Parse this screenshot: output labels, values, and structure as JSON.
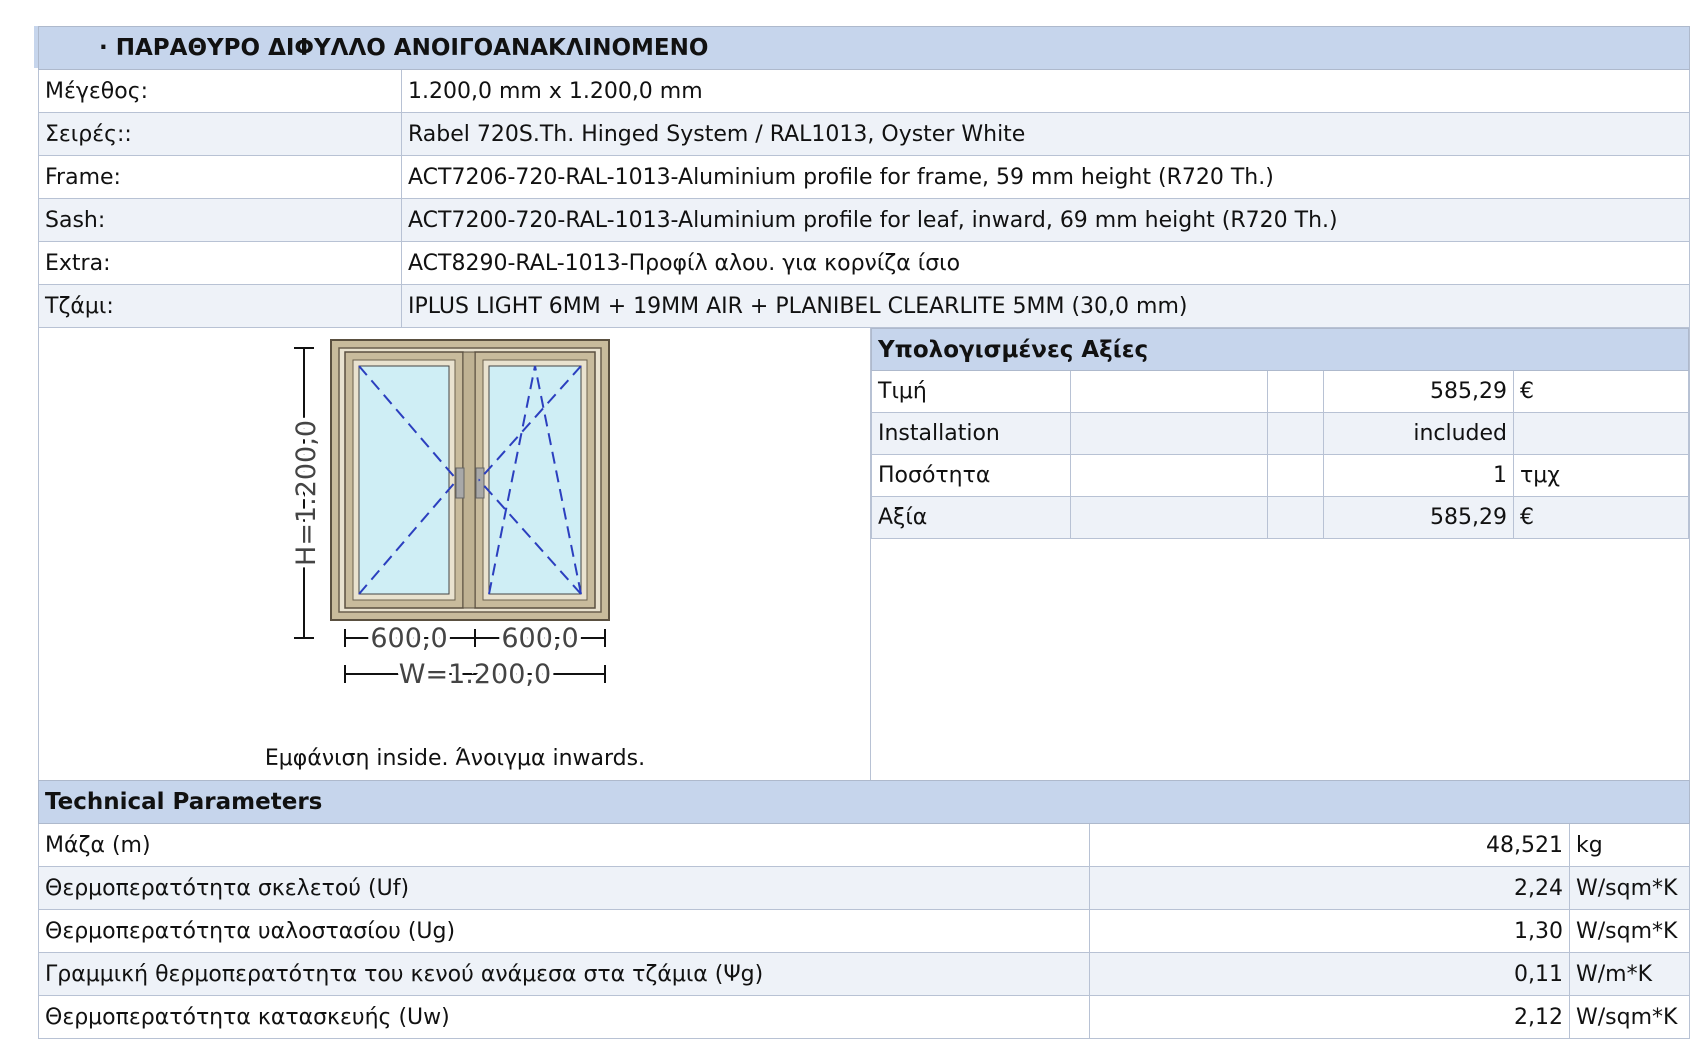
{
  "title": "· ΠΑΡΑΘΥΡΟ ΔΙΦΥΛΛΟ ΑΝΟΙΓΟΑΝΑΚΛΙΝΟΜΕΝΟ",
  "specs": [
    {
      "label": "Μέγεθος:",
      "value": "1.200,0 mm x 1.200,0 mm"
    },
    {
      "label": "Σειρές::",
      "value": "Rabel 720S.Th. Hinged System / RAL1013, Oyster White"
    },
    {
      "label": "Frame:",
      "value": "ACT7206-720-RAL-1013-Aluminium profile for frame, 59 mm height (R720 Th.)"
    },
    {
      "label": "Sash:",
      "value": "ACT7200-720-RAL-1013-Aluminium profile for leaf, inward, 69 mm height (R720 Th.)"
    },
    {
      "label": "Extra:",
      "value": "ACT8290-RAL-1013-Προφίλ αλου. για κορνίζα ίσιο"
    },
    {
      "label": "Τζάμι:",
      "value": "IPLUS LIGHT 6MM + 19MM AIR + PLANIBEL CLEARLITE 5MM (30,0 mm)"
    }
  ],
  "drawing": {
    "height_label": "H=1.200,0",
    "left_width_label": "600,0",
    "right_width_label": "600,0",
    "total_width_label": "W=1.200,0",
    "caption": "Εμφάνιση inside. Άνοιγμα inwards.",
    "frame_color": "#c8bb9c",
    "glass_color": "#cfeef5",
    "line_color": "#2b3fbf"
  },
  "calc": {
    "header": "Υπολογισμένες Αξίες",
    "rows": [
      {
        "label": "Τιμή",
        "value": "585,29",
        "unit": "€"
      },
      {
        "label": "Installation",
        "value": "included",
        "unit": ""
      },
      {
        "label": "Ποσότητα",
        "value": "1",
        "unit": "τμχ"
      },
      {
        "label": "Αξία",
        "value": "585,29",
        "unit": "€"
      }
    ]
  },
  "technical": {
    "header": "Technical Parameters",
    "rows": [
      {
        "label": "Μάζα (m)",
        "value": "48,521",
        "unit": "kg"
      },
      {
        "label": "Θερμοπερατότητα σκελετού (Uf)",
        "value": "2,24",
        "unit": "W/sqm*K"
      },
      {
        "label": "Θερμοπερατότητα υαλοστασίου (Ug)",
        "value": "1,30",
        "unit": "W/sqm*K"
      },
      {
        "label": "Γραμμική θερμοπερατότητα του κενού ανάμεσα στα τζάμια (Ψg)",
        "value": "0,11",
        "unit": "W/m*K"
      },
      {
        "label": "Θερμοπερατότητα κατασκευής (Uw)",
        "value": "2,12",
        "unit": "W/sqm*K"
      }
    ]
  },
  "colors": {
    "header_bg": "#c6d5ec",
    "alt_row_bg": "#eef2f8",
    "border": "#b8c2d4"
  }
}
